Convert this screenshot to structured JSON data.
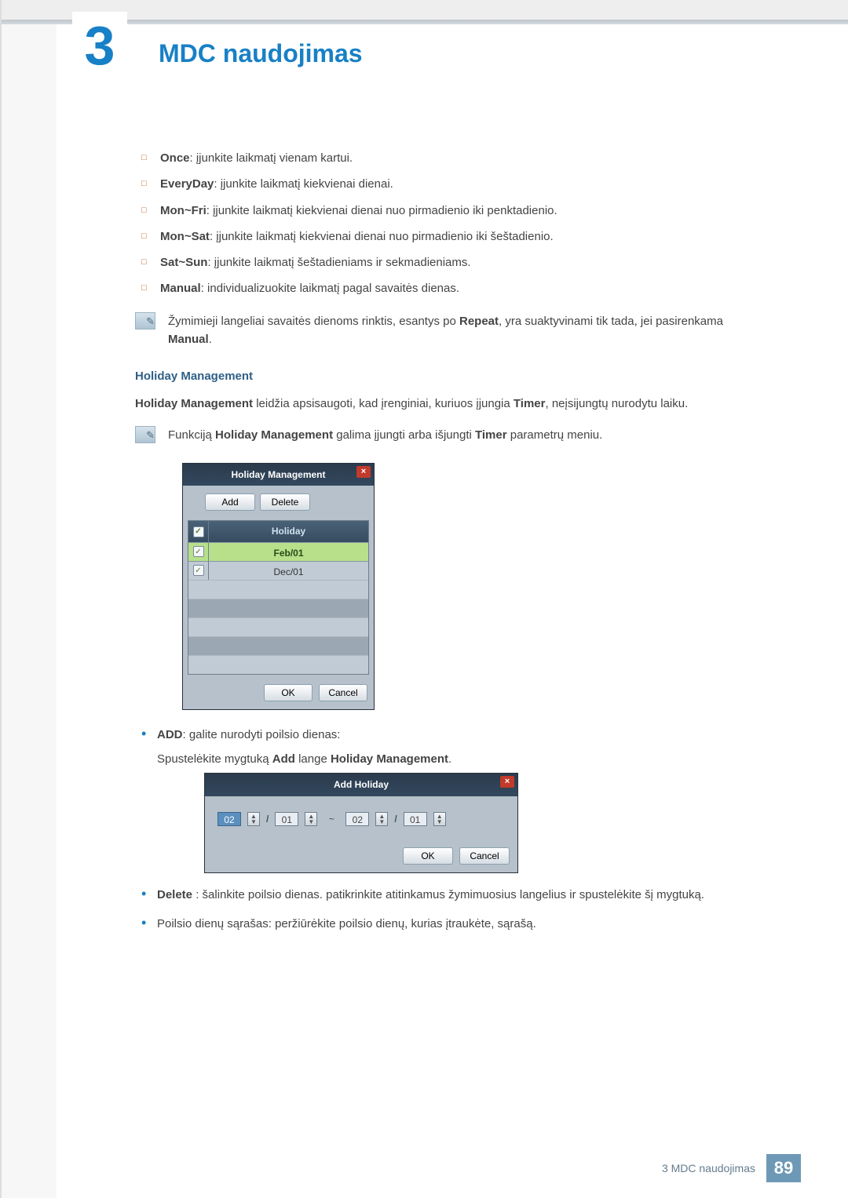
{
  "chapter_number": "3",
  "page_title": "MDC naudojimas",
  "options": [
    {
      "label": "Once",
      "desc": ": įjunkite laikmatį vienam kartui."
    },
    {
      "label": "EveryDay",
      "desc": ": įjunkite laikmatį kiekvienai dienai."
    },
    {
      "label": "Mon~Fri",
      "desc": ": įjunkite laikmatį kiekvienai dienai nuo pirmadienio iki penktadienio."
    },
    {
      "label": "Mon~Sat",
      "desc": ": įjunkite laikmatį kiekvienai dienai nuo pirmadienio iki šeštadienio."
    },
    {
      "label": "Sat~Sun",
      "desc": ": įjunkite laikmatį šeštadieniams ir sekmadieniams."
    },
    {
      "label": "Manual",
      "desc": ": individualizuokite laikmatį pagal savaitės dienas."
    }
  ],
  "note1_pre": "Žymimieji langeliai savaitės dienoms rinktis, esantys po ",
  "note1_bold1": "Repeat",
  "note1_mid": ", yra suaktyvinami tik tada, jei pasirenkama ",
  "note1_bold2": "Manual",
  "note1_post": ".",
  "section_heading": "Holiday Management",
  "hm_para_b1": "Holiday Management",
  "hm_para_t1": " leidžia apsisaugoti, kad įrenginiai, kuriuos įjungia ",
  "hm_para_b2": "Timer",
  "hm_para_t2": ", neįsijungtų nurodytu laiku.",
  "note2_pre": "Funkciją ",
  "note2_b1": "Holiday Management",
  "note2_mid": " galima įjungti arba išjungti ",
  "note2_b2": "Timer",
  "note2_post": " parametrų meniu.",
  "hm_dialog": {
    "title": "Holiday Management",
    "close": "×",
    "add": "Add",
    "delete": "Delete",
    "col_header": "Holiday",
    "rows": [
      {
        "checked": true,
        "name": "Feb/01",
        "selected": true
      },
      {
        "checked": true,
        "name": "Dec/01",
        "selected": false
      }
    ],
    "ok": "OK",
    "cancel": "Cancel"
  },
  "bullets": {
    "add_label": "ADD",
    "add_desc": ": galite nurodyti poilsio dienas:",
    "add_sub_pre": "Spustelėkite mygtuką ",
    "add_sub_b1": "Add",
    "add_sub_mid": " lange ",
    "add_sub_b2": "Holiday Management",
    "add_sub_post": ".",
    "del_label": "Delete",
    "del_desc": " : šalinkite poilsio dienas. patikrinkite atitinkamus žymimuosius langelius ir spustelėkite šį mygtuką.",
    "list_desc": "Poilsio dienų sąrašas: peržiūrėkite poilsio dienų, kurias įtraukėte, sąrašą."
  },
  "ah_dialog": {
    "title": "Add Holiday",
    "close": "×",
    "from_month": "02",
    "from_day": "01",
    "tilde": "~",
    "to_month": "02",
    "to_day": "01",
    "ok": "OK",
    "cancel": "Cancel"
  },
  "footer_label": "3 MDC naudojimas",
  "footer_page": "89"
}
